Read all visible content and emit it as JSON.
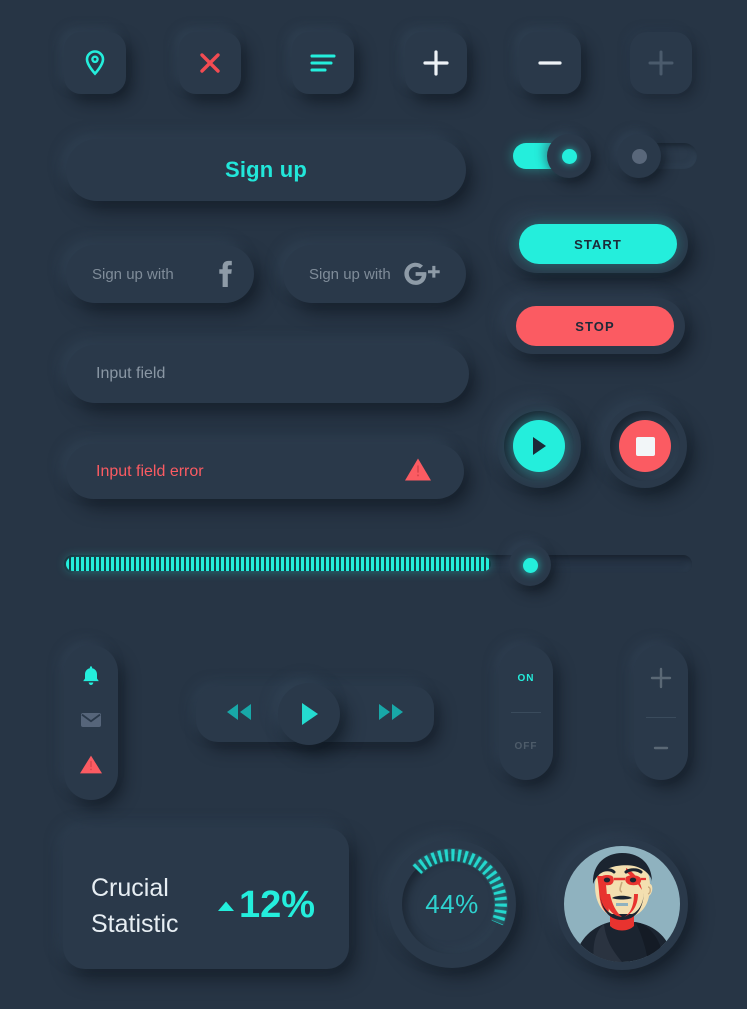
{
  "theme": {
    "background": "#273545",
    "surface": "#2A394A",
    "accent_cyan": "#24EEDC",
    "accent_red": "#FB5B62",
    "text_muted": "#8A97A4",
    "text_light": "#E7EEF3"
  },
  "top_icon_buttons": [
    {
      "name": "location-pin-icon",
      "icon": "location-pin",
      "color": "#24EEDC",
      "state": "enabled"
    },
    {
      "name": "close-icon",
      "icon": "close-x",
      "color": "#FB5B62",
      "state": "enabled"
    },
    {
      "name": "menu-icon",
      "icon": "hamburger-menu",
      "color": "#24EEDC",
      "state": "enabled"
    },
    {
      "name": "plus-icon",
      "icon": "plus",
      "color": "#EDF2F6",
      "state": "enabled"
    },
    {
      "name": "minus-icon",
      "icon": "minus",
      "color": "#EDF2F6",
      "state": "enabled"
    },
    {
      "name": "plus-disabled-icon",
      "icon": "plus",
      "color": "#4A5A6B",
      "state": "disabled"
    }
  ],
  "signup": {
    "primary_label": "Sign up",
    "social": [
      {
        "label": "Sign up with",
        "provider": "facebook",
        "icon": "facebook-icon"
      },
      {
        "label": "Sign up with",
        "provider": "google-plus",
        "icon": "google-plus-icon"
      }
    ]
  },
  "inputs": [
    {
      "placeholder": "Input field",
      "state": "normal",
      "value": ""
    },
    {
      "placeholder": "Input field error",
      "state": "error",
      "value": "",
      "icon": "warning-triangle-icon"
    }
  ],
  "toggles": [
    {
      "name": "toggle-on",
      "state": "on",
      "label": "",
      "knob_color": "#24EEDC"
    },
    {
      "name": "toggle-off",
      "state": "off",
      "label": "",
      "knob_color": "#5A6775"
    }
  ],
  "action_buttons": [
    {
      "label": "START",
      "color": "#24EEDC",
      "name": "start-button"
    },
    {
      "label": "STOP",
      "color": "#FB5B62",
      "name": "stop-button"
    }
  ],
  "transport_circles": [
    {
      "name": "play-circle-button",
      "icon": "play-icon",
      "color": "#24EEDC",
      "glyph_color": "#1C2A38"
    },
    {
      "name": "stop-circle-button",
      "icon": "stop-square-icon",
      "color": "#FB5B62",
      "glyph_color": "#F2F6F8"
    }
  ],
  "slider": {
    "name": "range-slider",
    "value_percent": 76,
    "min": 0,
    "max": 100,
    "fill_color": "#24EEDC",
    "knob_dot_color": "#24EEDC"
  },
  "notification_pill": {
    "items": [
      {
        "name": "bell-icon",
        "icon": "bell",
        "color": "#24EEDC"
      },
      {
        "name": "mail-icon",
        "icon": "envelope",
        "color": "#56657A"
      },
      {
        "name": "alert-icon",
        "icon": "warning-triangle",
        "color": "#FB5B62"
      }
    ]
  },
  "media_player": {
    "rewind": {
      "name": "rewind-icon",
      "icon": "double-left-arrow",
      "color": "#18A8A8"
    },
    "play": {
      "name": "play-button",
      "icon": "play",
      "color": "#24DCD0"
    },
    "forward": {
      "name": "forward-icon",
      "icon": "double-right-arrow",
      "color": "#18A8A8"
    }
  },
  "on_off_switch": {
    "name": "on-off-switch",
    "on_label": "ON",
    "off_label": "OFF",
    "selected": "ON",
    "on_color": "#24EEDC",
    "off_color": "#55636F"
  },
  "stepper": {
    "name": "plus-minus-stepper",
    "plus_label": "+",
    "minus_label": "−",
    "color": "#5A6875"
  },
  "stat_card": {
    "title_line_1": "Crucial",
    "title_line_2": "Statistic",
    "delta_value": "12%",
    "delta_direction": "up",
    "delta_color": "#24EEDC"
  },
  "gauge": {
    "name": "progress-gauge",
    "value_label": "44%",
    "value_percent": 44,
    "arc_color": "#24D8CE"
  },
  "avatar": {
    "name": "user-avatar",
    "alt": "illustrated bearded man with glasses",
    "background": "#8FB2BF",
    "skin": "#F3DFB0",
    "accent": "#E8332F",
    "dark": "#1B2430"
  }
}
